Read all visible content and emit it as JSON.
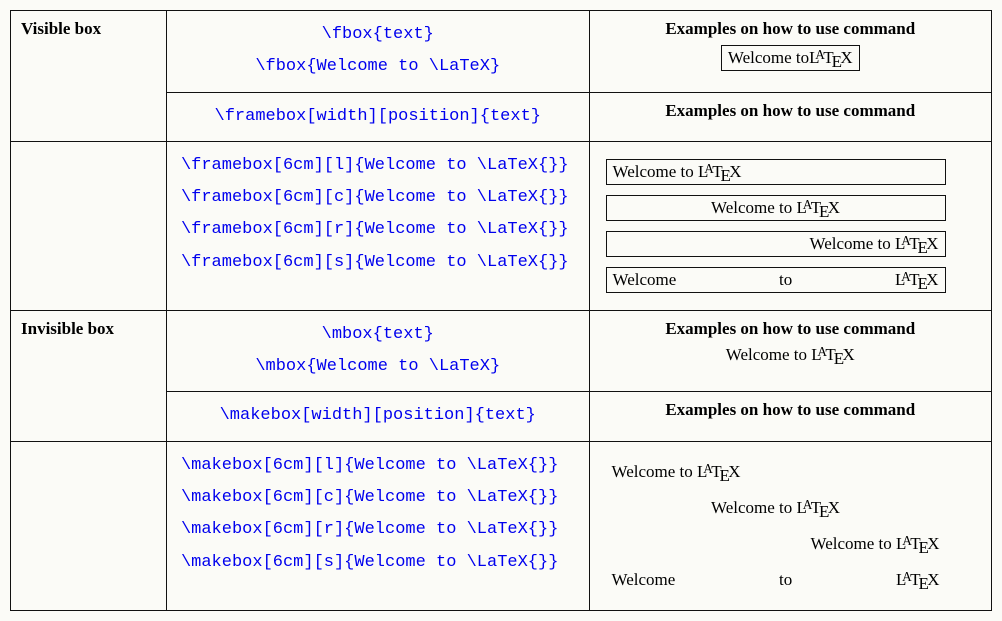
{
  "sections": {
    "visible": {
      "label": "Visible box",
      "syntax1a": "\\fbox{text}",
      "syntax1b": "\\fbox{Welcome to \\LaTeX}",
      "heading": "Examples on how to use command",
      "syntax2": "\\framebox[width][position]{text}",
      "code_l": "\\framebox[6cm][l]{Welcome to \\LaTeX{}}",
      "code_c": "\\framebox[6cm][c]{Welcome to \\LaTeX{}}",
      "code_r": "\\framebox[6cm][r]{Welcome to \\LaTeX{}}",
      "code_s": "\\framebox[6cm][s]{Welcome to \\LaTeX{}}"
    },
    "invisible": {
      "label": "Invisible box",
      "syntax1a": "\\mbox{text}",
      "syntax1b": "\\mbox{Welcome to \\LaTeX}",
      "heading": "Examples on how to use command",
      "syntax2": "\\makebox[width][position]{text}",
      "code_l": "\\makebox[6cm][l]{Welcome to \\LaTeX{}}",
      "code_c": "\\makebox[6cm][c]{Welcome to \\LaTeX{}}",
      "code_r": "\\makebox[6cm][r]{Welcome to \\LaTeX{}}",
      "code_s": "\\makebox[6cm][s]{Welcome to \\LaTeX{}}"
    }
  },
  "sample": {
    "prefix": "Welcome to ",
    "w1": "Welcome",
    "w2": "to"
  },
  "chart_data": {
    "type": "table",
    "title": "LaTeX box commands",
    "rows": [
      {
        "category": "Visible box",
        "command": "\\fbox{text}",
        "example": "Welcome to LaTeX (framed)"
      },
      {
        "category": "Visible box",
        "command": "\\framebox[width][position]{text}",
        "positions": [
          "l",
          "c",
          "r",
          "s"
        ],
        "width": "6cm",
        "content": "Welcome to \\LaTeX{}",
        "framed": true
      },
      {
        "category": "Invisible box",
        "command": "\\mbox{text}",
        "example": "Welcome to LaTeX"
      },
      {
        "category": "Invisible box",
        "command": "\\makebox[width][position]{text}",
        "positions": [
          "l",
          "c",
          "r",
          "s"
        ],
        "width": "6cm",
        "content": "Welcome to \\LaTeX{}",
        "framed": false
      }
    ]
  }
}
